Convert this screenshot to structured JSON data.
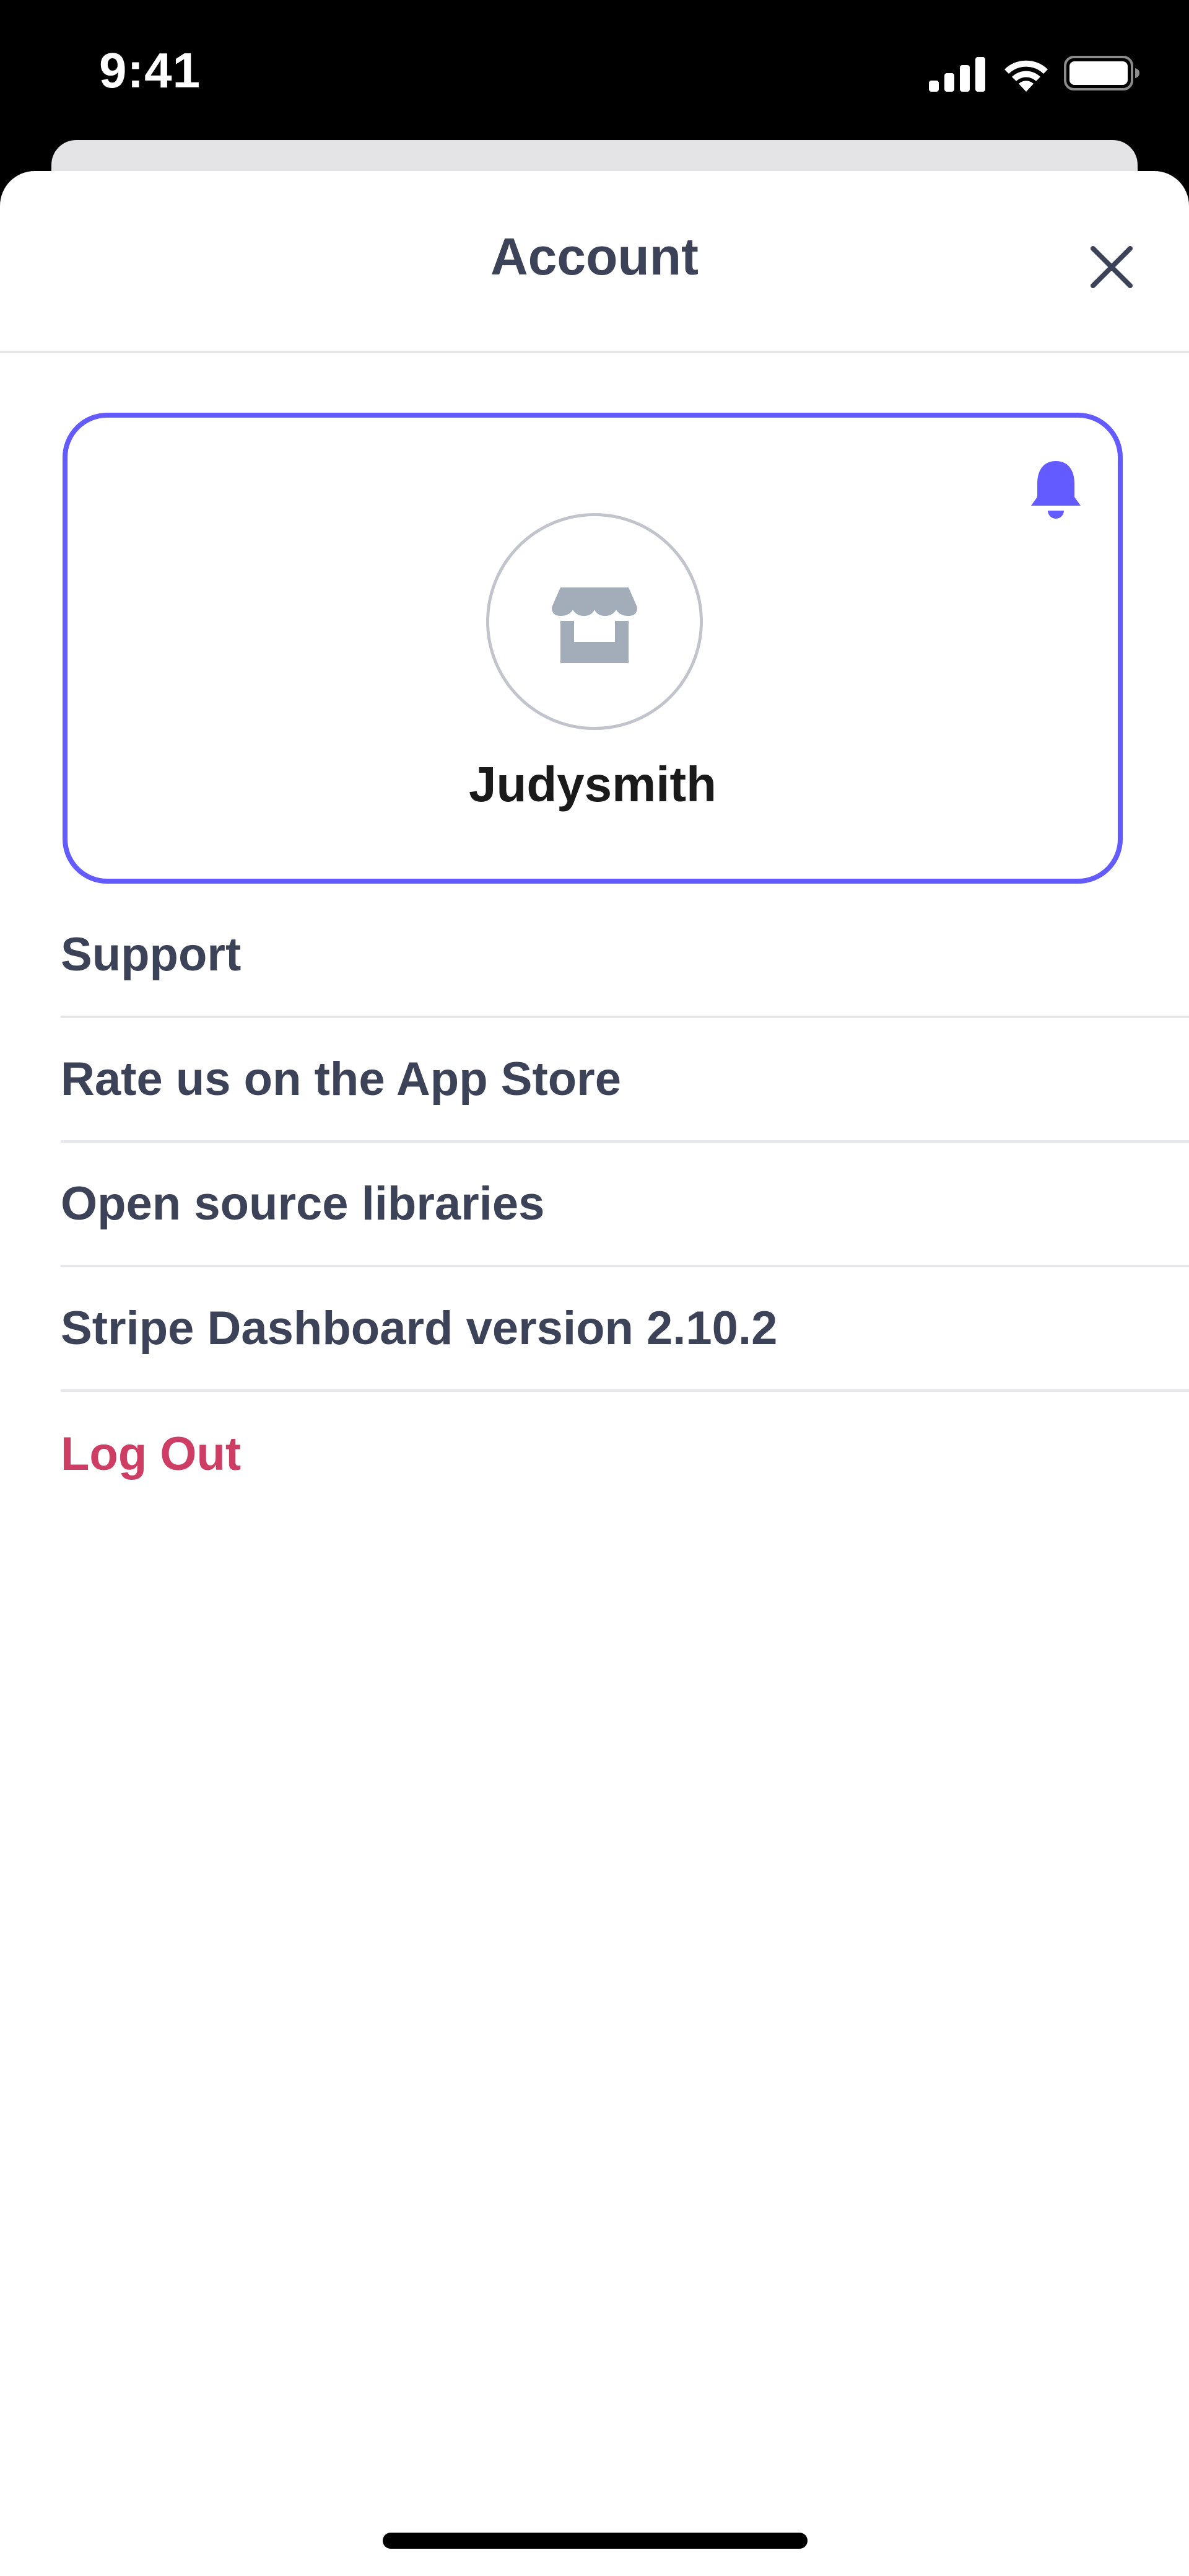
{
  "status_bar": {
    "time": "9:41",
    "icons": [
      "cellular-signal-icon",
      "wifi-icon",
      "battery-icon"
    ]
  },
  "header": {
    "title": "Account",
    "close_icon": "close-icon"
  },
  "profile": {
    "name": "Judysmith",
    "avatar_icon": "storefront-icon",
    "notification_icon": "bell-icon"
  },
  "menu": {
    "items": [
      {
        "label": "Support"
      },
      {
        "label": "Rate us on the App Store"
      },
      {
        "label": "Open source libraries"
      },
      {
        "label": "Stripe Dashboard version 2.10.2"
      },
      {
        "label": "Log Out"
      }
    ]
  },
  "colors": {
    "accent": "#635bff",
    "text_primary": "#3c4257",
    "destructive": "#cd3d64",
    "divider": "#e6e7ea",
    "icon_gray": "#a3acb9"
  }
}
